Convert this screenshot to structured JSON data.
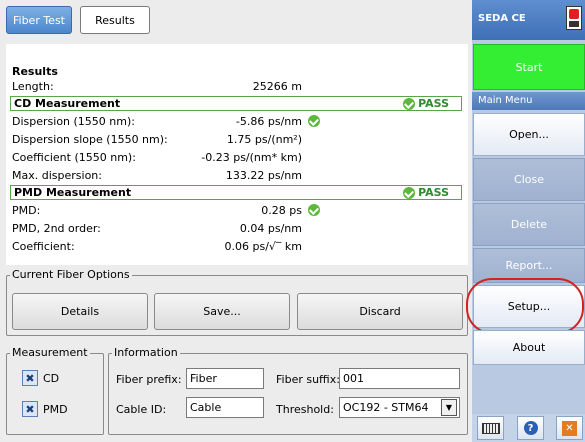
{
  "tabs": [
    {
      "label": "Fiber Test",
      "active": true
    },
    {
      "label": "Results",
      "active": false
    }
  ],
  "results": {
    "title": "Results",
    "length_label": "Length:",
    "length_value": "25266 m",
    "cd": {
      "header": "CD Measurement",
      "status": "PASS",
      "rows": [
        {
          "label": "Dispersion (1550 nm):",
          "value": "-5.86 ps/nm",
          "ok": true
        },
        {
          "label": "Dispersion slope (1550 nm):",
          "value": "1.75 ps/(nm²)",
          "ok": false
        },
        {
          "label": "Coefficient (1550 nm):",
          "value": "-0.23 ps/(nm* km)",
          "ok": false
        },
        {
          "label": "Max. dispersion:",
          "value": "133.22 ps/nm",
          "ok": false
        }
      ]
    },
    "pmd": {
      "header": "PMD Measurement",
      "status": "PASS",
      "rows": [
        {
          "label": "PMD:",
          "value": "0.28 ps",
          "ok": true
        },
        {
          "label": "PMD, 2nd order:",
          "value": "0.04 ps/nm",
          "ok": false
        },
        {
          "label": "Coefficient:",
          "value": "0.06 ps/√‾ km",
          "ok": false
        }
      ]
    }
  },
  "fiber_options": {
    "title": "Current Fiber Options",
    "details": "Details",
    "save": "Save...",
    "discard": "Discard"
  },
  "measurement": {
    "title": "Measurement",
    "cd": "CD",
    "pmd": "PMD",
    "cd_checked": true,
    "pmd_checked": true
  },
  "information": {
    "title": "Information",
    "fiber_prefix_label": "Fiber prefix:",
    "fiber_prefix": "Fiber",
    "fiber_suffix_label": "Fiber suffix:",
    "fiber_suffix": "001",
    "cable_id_label": "Cable ID:",
    "cable_id": "Cable",
    "threshold_label": "Threshold:",
    "threshold": "OC192 - STM64"
  },
  "sidebar": {
    "app_name": "SEDA CE",
    "start": "Start",
    "main_menu": "Main Menu",
    "open": "Open...",
    "close": "Close",
    "delete": "Delete",
    "report": "Report...",
    "setup": "Setup...",
    "about": "About",
    "close_x": "✕"
  },
  "colors": {
    "start_green": "#33ee33",
    "pass_green": "#2e8b2e",
    "highlight_red": "#d22222",
    "sidebar_bg": "#b9c9e2"
  }
}
